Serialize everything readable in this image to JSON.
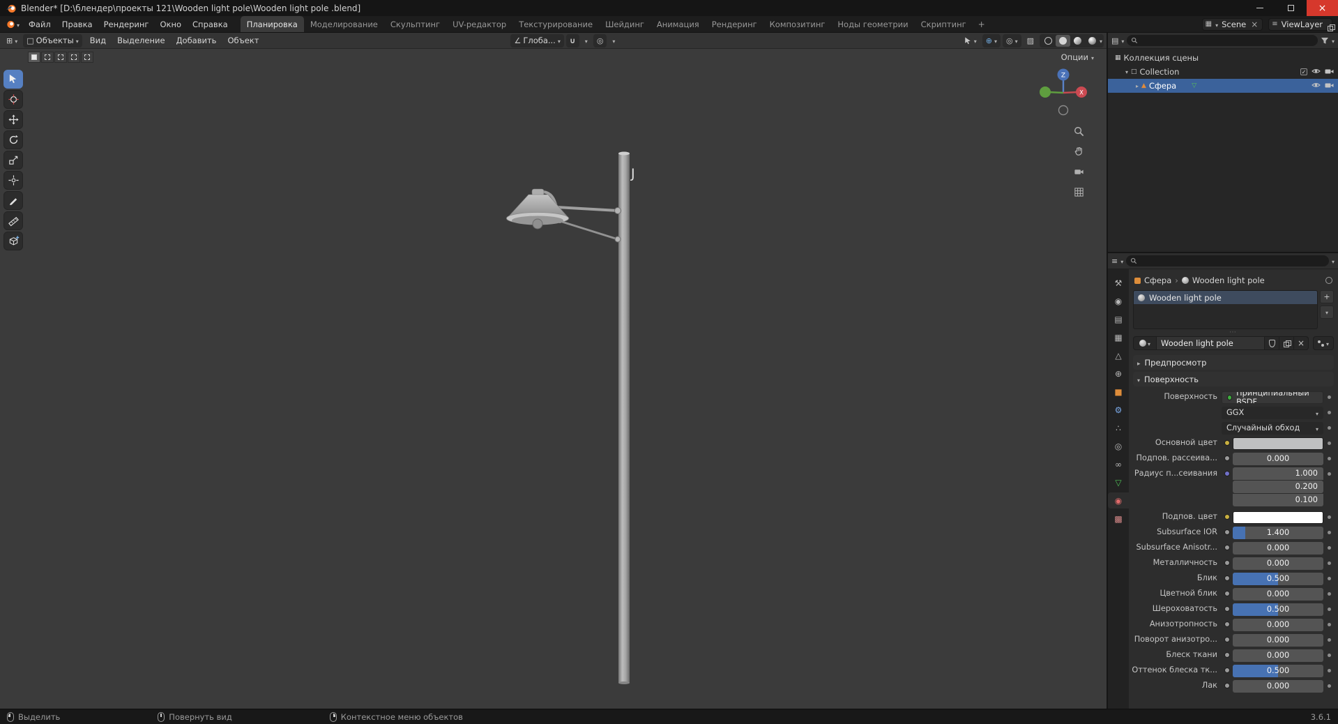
{
  "window": {
    "title": "Blender* [D:\\блендер\\проекты 121\\Wooden light pole\\Wooden light pole .blend]"
  },
  "topbar": {
    "menus": [
      "Файл",
      "Правка",
      "Рендеринг",
      "Окно",
      "Справка"
    ],
    "workspaces": [
      "Планировка",
      "Моделирование",
      "Скульптинг",
      "UV-редактор",
      "Текстурирование",
      "Шейдинг",
      "Анимация",
      "Рендеринг",
      "Композитинг",
      "Ноды геометрии",
      "Скриптинг"
    ],
    "active_workspace": "Планировка",
    "add_workspace_label": "+",
    "scene": "Scene",
    "view_layer": "ViewLayer"
  },
  "viewport": {
    "header": {
      "mode": "Объекты",
      "menus": [
        "Вид",
        "Выделение",
        "Добавить",
        "Объект"
      ],
      "orientation": "Глоба..."
    },
    "options_label": "Опции",
    "text_overlay": "J",
    "gizmo": {
      "z": "Z",
      "x": "X"
    }
  },
  "outliner": {
    "rows": [
      {
        "label": "Коллекция сцены"
      },
      {
        "label": "Collection"
      },
      {
        "label": "Сфера"
      }
    ]
  },
  "properties": {
    "breadcrumb": {
      "object": "Сфера",
      "material": "Wooden light pole"
    },
    "slot_name": "Wooden light pole",
    "material_name": "Wooden light pole",
    "active_tab": "material",
    "panels": {
      "preview": "Предпросмотр",
      "surface": "Поверхность"
    },
    "surface_rows": [
      {
        "label": "Поверхность",
        "type": "shader",
        "value": "Принципиальный BSDF",
        "socket": "#3fae3f"
      },
      {
        "label": "",
        "type": "dropdown",
        "value": "GGX"
      },
      {
        "label": "",
        "type": "dropdown",
        "value": "Случайный обход"
      },
      {
        "label": "Основной цвет",
        "type": "color",
        "value": "#bfc0c1",
        "socket": "#c9b040"
      },
      {
        "label": "Подпов. рассеива...",
        "type": "slider",
        "value": "0.000",
        "fill": 0,
        "socket": "#9a9a9a"
      },
      {
        "label": "Радиус п...сеивания",
        "type": "vector",
        "values": [
          "1.000",
          "0.200",
          "0.100"
        ],
        "socket": "#7070c8"
      },
      {
        "label": "Подпов. цвет",
        "type": "color",
        "value": "#ffffff",
        "socket": "#c9b040"
      },
      {
        "label": "Subsurface IOR",
        "type": "slider",
        "value": "1.400",
        "fill": 0.14,
        "socket": "#9a9a9a"
      },
      {
        "label": "Subsurface Anisotr...",
        "type": "slider",
        "value": "0.000",
        "fill": 0,
        "socket": "#9a9a9a"
      },
      {
        "label": "Металличность",
        "type": "slider",
        "value": "0.000",
        "fill": 0,
        "socket": "#9a9a9a"
      },
      {
        "label": "Блик",
        "type": "slider",
        "value": "0.500",
        "fill": 0.5,
        "socket": "#9a9a9a"
      },
      {
        "label": "Цветной блик",
        "type": "slider",
        "value": "0.000",
        "fill": 0,
        "socket": "#9a9a9a"
      },
      {
        "label": "Шероховатость",
        "type": "slider",
        "value": "0.500",
        "fill": 0.5,
        "socket": "#9a9a9a"
      },
      {
        "label": "Анизотропность",
        "type": "slider",
        "value": "0.000",
        "fill": 0,
        "socket": "#9a9a9a"
      },
      {
        "label": "Поворот анизотро...",
        "type": "slider",
        "value": "0.000",
        "fill": 0,
        "socket": "#9a9a9a"
      },
      {
        "label": "Блеск ткани",
        "type": "slider",
        "value": "0.000",
        "fill": 0,
        "socket": "#9a9a9a"
      },
      {
        "label": "Оттенок блеска тк...",
        "type": "slider",
        "value": "0.500",
        "fill": 0.5,
        "socket": "#9a9a9a"
      },
      {
        "label": "Лак",
        "type": "slider",
        "value": "0.000",
        "fill": 0,
        "socket": "#9a9a9a"
      }
    ]
  },
  "statusbar": {
    "hints": [
      {
        "label": "Выделить",
        "button": "left"
      },
      {
        "label": "Повернуть вид",
        "button": "middle"
      },
      {
        "label": "Контекстное меню объектов",
        "button": "right"
      }
    ],
    "version": "3.6.1"
  },
  "colors": {
    "accent": "#4772b3",
    "selection": "#3b629b",
    "viewport_bg": "#3b3b3b"
  }
}
